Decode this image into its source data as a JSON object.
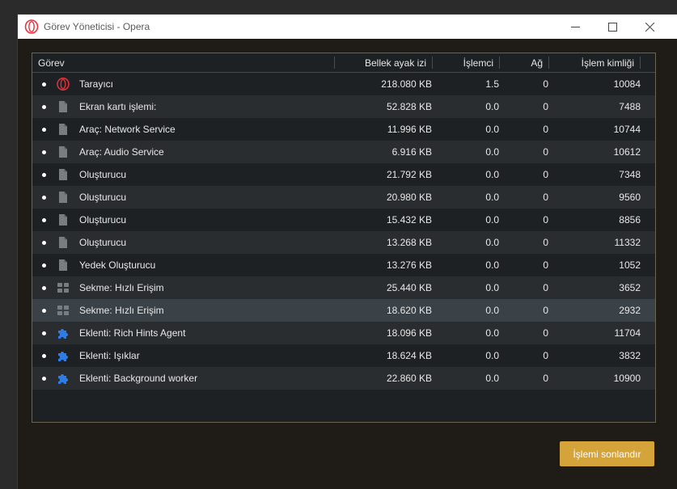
{
  "window": {
    "title": "Görev Yöneticisi - Opera",
    "app_icon": "opera-icon"
  },
  "table": {
    "headers": {
      "task": "Görev",
      "memory": "Bellek ayak izi",
      "cpu": "İşlemci",
      "network": "Ağ",
      "pid": "İşlem kimliği"
    },
    "rows": [
      {
        "icon": "opera-icon",
        "name": "Tarayıcı",
        "memory": "218.080 KB",
        "cpu": "1.5",
        "network": "0",
        "pid": "10084"
      },
      {
        "icon": "document-icon",
        "name": "Ekran kartı işlemi:",
        "memory": "52.828 KB",
        "cpu": "0.0",
        "network": "0",
        "pid": "7488"
      },
      {
        "icon": "document-icon",
        "name": "Araç: Network Service",
        "memory": "11.996 KB",
        "cpu": "0.0",
        "network": "0",
        "pid": "10744"
      },
      {
        "icon": "document-icon",
        "name": "Araç: Audio Service",
        "memory": "6.916 KB",
        "cpu": "0.0",
        "network": "0",
        "pid": "10612"
      },
      {
        "icon": "document-icon",
        "name": "Oluşturucu",
        "memory": "21.792 KB",
        "cpu": "0.0",
        "network": "0",
        "pid": "7348"
      },
      {
        "icon": "document-icon",
        "name": "Oluşturucu",
        "memory": "20.980 KB",
        "cpu": "0.0",
        "network": "0",
        "pid": "9560"
      },
      {
        "icon": "document-icon",
        "name": "Oluşturucu",
        "memory": "15.432 KB",
        "cpu": "0.0",
        "network": "0",
        "pid": "8856"
      },
      {
        "icon": "document-icon",
        "name": "Oluşturucu",
        "memory": "13.268 KB",
        "cpu": "0.0",
        "network": "0",
        "pid": "11332"
      },
      {
        "icon": "document-icon",
        "name": "Yedek Oluşturucu",
        "memory": "13.276 KB",
        "cpu": "0.0",
        "network": "0",
        "pid": "1052"
      },
      {
        "icon": "speed-dial-icon",
        "name": "Sekme: Hızlı Erişim",
        "memory": "25.440 KB",
        "cpu": "0.0",
        "network": "0",
        "pid": "3652"
      },
      {
        "icon": "speed-dial-icon",
        "name": "Sekme: Hızlı Erişim",
        "memory": "18.620 KB",
        "cpu": "0.0",
        "network": "0",
        "pid": "2932",
        "selected": true
      },
      {
        "icon": "puzzle-icon",
        "name": "Eklenti: Rich Hints Agent",
        "memory": "18.096 KB",
        "cpu": "0.0",
        "network": "0",
        "pid": "11704"
      },
      {
        "icon": "puzzle-icon",
        "name": "Eklenti: Işıklar",
        "memory": "18.624 KB",
        "cpu": "0.0",
        "network": "0",
        "pid": "3832"
      },
      {
        "icon": "puzzle-icon",
        "name": "Eklenti: Background worker",
        "memory": "22.860 KB",
        "cpu": "0.0",
        "network": "0",
        "pid": "10900"
      }
    ]
  },
  "actions": {
    "end_process_label": "İşlemi sonlandır"
  },
  "colors": {
    "accent": "#d4a33a",
    "opera_red": "#e8323c",
    "extension_blue": "#2e7be6",
    "selected_row": "#3a4147"
  }
}
